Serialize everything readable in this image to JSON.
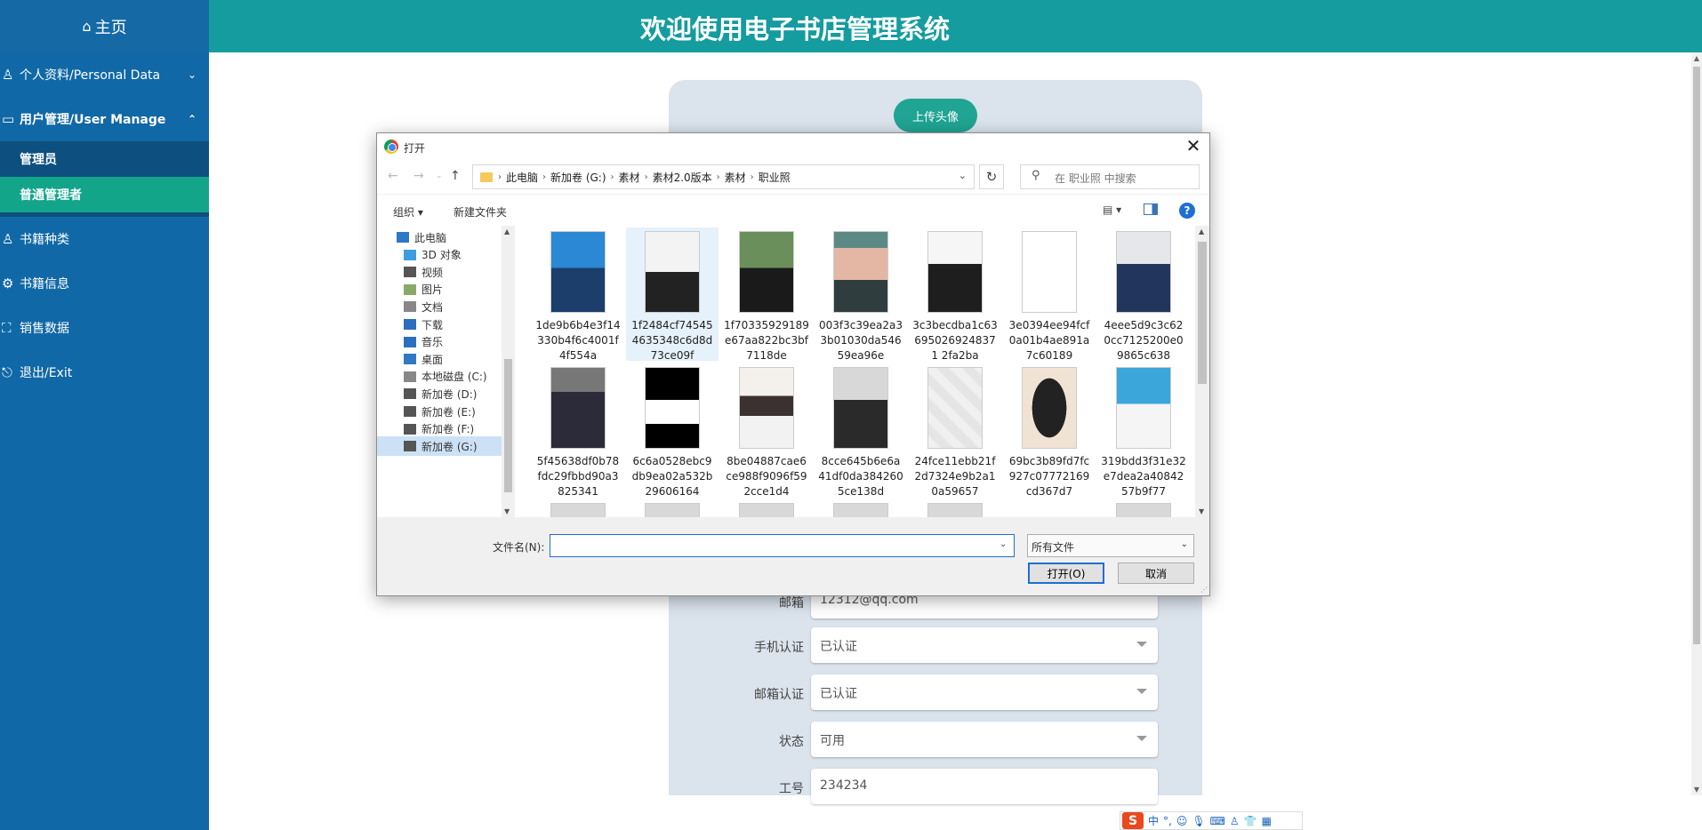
{
  "sidebar": {
    "home": "主页",
    "items": [
      {
        "label": "个人资料/Personal Data",
        "arrow": "⌄"
      },
      {
        "label": "用户管理/User Manage",
        "arrow": "⌃"
      }
    ],
    "subitems": [
      "管理员",
      "普通管理者"
    ],
    "bottom_items": [
      "书籍种类",
      "书籍信息",
      "销售数据",
      "退出/Exit"
    ]
  },
  "header": {
    "title": "欢迎使用电子书店管理系统"
  },
  "card": {
    "upload_label": "上传头像",
    "fields": [
      {
        "label": "邮箱",
        "value": "12312@qq.com"
      },
      {
        "label": "手机认证",
        "value": "已认证"
      },
      {
        "label": "邮箱认证",
        "value": "已认证"
      },
      {
        "label": "状态",
        "value": "可用"
      },
      {
        "label": "工号",
        "value": "234234"
      }
    ]
  },
  "dialog": {
    "title": "打开",
    "breadcrumb": [
      "此电脑",
      "新加卷 (G:)",
      "素材",
      "素材2.0版本",
      "素材",
      "职业照"
    ],
    "search_placeholder": "在 职业照 中搜索",
    "organize": "组织 ▾",
    "new_folder": "新建文件夹",
    "tree": [
      "此电脑",
      "3D 对象",
      "视频",
      "图片",
      "文档",
      "下载",
      "音乐",
      "桌面",
      "本地磁盘 (C:)",
      "新加卷 (D:)",
      "新加卷 (E:)",
      "新加卷 (F:)",
      "新加卷 (G:)"
    ],
    "files": [
      {
        "name": "1de9b6b4e3f14330b4f6c4001f4f554a",
        "style": "p-blue"
      },
      {
        "name": "1f2484cf745454635348c6d8d73ce09f",
        "style": "p-white"
      },
      {
        "name": "1f70335929189e67aa822bc3bf7118de",
        "style": "p-green"
      },
      {
        "name": "003f3c39ea2a33b01030da54659ea96e",
        "style": "p-pink"
      },
      {
        "name": "3c3becdba1c636950269248371 2fa2ba",
        "style": "p-suit"
      },
      {
        "name": "3e0394ee94fcf0a01b4ae891a7c60189",
        "style": "p-check"
      },
      {
        "name": "4eee5d9c3c620cc7125200e09865c638",
        "style": "p-navy"
      },
      {
        "name": "5f45638df0b78fdc29fbbd90a3825341",
        "style": "p-stage"
      },
      {
        "name": "6c6a0528ebc9db9ea02a532b29606164",
        "style": "p-black"
      },
      {
        "name": "8be04887cae6ce988f9096f592cce1d4",
        "style": "p-beige"
      },
      {
        "name": "8cce645b6e6a41df0da3842605ce138d",
        "style": "p-gray"
      },
      {
        "name": "24fce11ebb21f2d7324e9b2a10a59657",
        "style": "p-faint"
      },
      {
        "name": "69bc3b89fd7fc927c07772169cd367d7",
        "style": "p-oval"
      },
      {
        "name": "319bdd3f31e32e7dea2a4084257b9f77",
        "style": "p-cyan"
      }
    ],
    "filename_label": "文件名(N):",
    "filename_value": "",
    "filetype": "所有文件",
    "open_label": "打开(O)",
    "cancel_label": "取消"
  },
  "ime": {
    "logo": "S",
    "lang": "中"
  }
}
